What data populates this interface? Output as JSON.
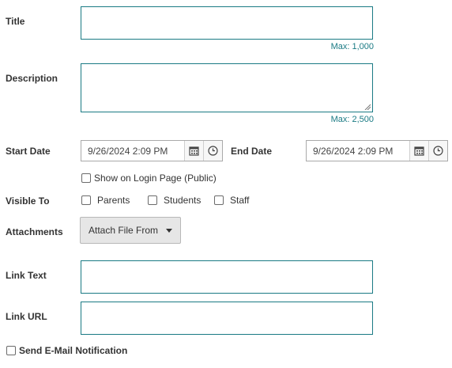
{
  "form": {
    "title": {
      "label": "Title",
      "value": "",
      "max": "Max: 1,000"
    },
    "description": {
      "label": "Description",
      "value": "",
      "max": "Max: 2,500"
    },
    "start_date": {
      "label": "Start Date",
      "value": "9/26/2024 2:09 PM"
    },
    "end_date": {
      "label": "End Date",
      "value": "9/26/2024 2:09 PM"
    },
    "show_on_login": {
      "label": "Show on Login Page (Public)",
      "checked": false
    },
    "visible_to": {
      "label": "Visible To",
      "options": [
        {
          "label": "Parents",
          "checked": false
        },
        {
          "label": "Students",
          "checked": false
        },
        {
          "label": "Staff",
          "checked": false
        }
      ]
    },
    "attachments": {
      "label": "Attachments",
      "button_label": "Attach File From"
    },
    "link_text": {
      "label": "Link Text",
      "value": ""
    },
    "link_url": {
      "label": "Link URL",
      "value": ""
    },
    "send_email": {
      "label": "Send E-Mail Notification",
      "checked": false
    }
  },
  "icons": {
    "calendar": "calendar-icon",
    "clock": "clock-icon",
    "dropdown": "caret-down-icon"
  },
  "colors": {
    "accent": "#1a7a84",
    "label_text": "#333333",
    "button_bg": "#e6e6e6"
  }
}
